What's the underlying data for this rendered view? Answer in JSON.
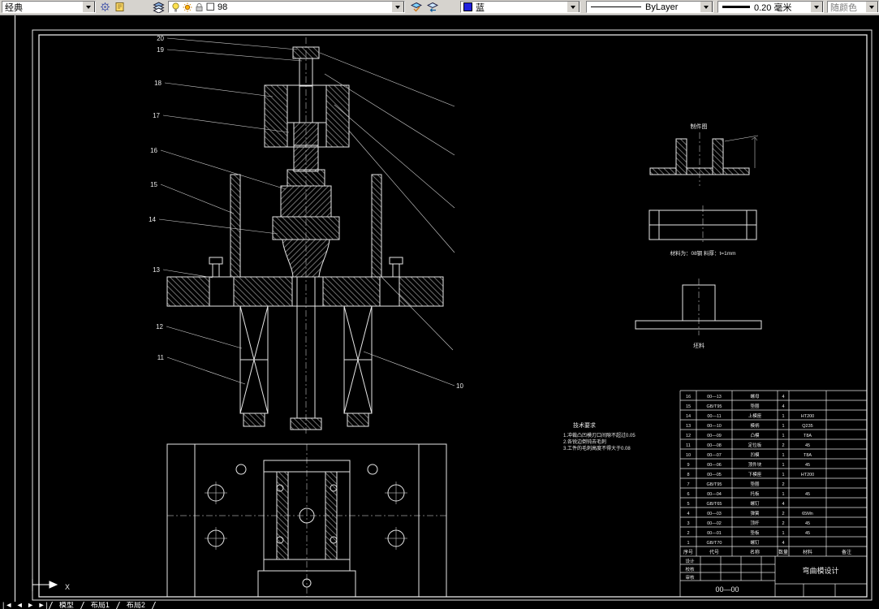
{
  "toolbar": {
    "workspace": "经典",
    "layer_value": "98",
    "color_value": "蓝",
    "linetype_value": "ByLayer",
    "lineweight_value": "0.20 毫米",
    "plotstyle_value": "随颜色",
    "icons": [
      "gear-icon",
      "sheet-icon",
      "layers-icon",
      "bulb-icon",
      "sun-icon",
      "lock-icon",
      "color-chip-icon",
      "make-layer-current-icon",
      "layer-previous-icon"
    ]
  },
  "drawing": {
    "balloon_labels_left": [
      "20",
      "19",
      "18",
      "17",
      "16",
      "15",
      "14",
      "13",
      "12",
      "11"
    ],
    "balloon_label_right": "10",
    "detail_view_title": "制件图",
    "material_note": "材料为：08钢  料厚：t=1mm",
    "blank_label": "坯料",
    "tech_requirements": {
      "title": "技术要求",
      "items": [
        "1.冲裁凸凹模刃口间隙不超过0.05",
        "2.各锐边倒钝去毛刺",
        "3.工件的毛刺高度不得大于0.08"
      ]
    }
  },
  "title_block": {
    "drawing_title": "弯曲模设计",
    "drawing_number": "00—00",
    "bom_header": {
      "no": "序号",
      "code": "代号",
      "name": "名称",
      "qty": "数量",
      "mat": "材料",
      "rem": "备注"
    },
    "fields": {
      "design": "设计",
      "check": "校核",
      "approve": "审核"
    },
    "bom": [
      {
        "no": "16",
        "code": "00—13",
        "name": "螺母",
        "qty": "4",
        "mat": "",
        "rem": ""
      },
      {
        "no": "15",
        "code": "GB/T95",
        "name": "垫圈",
        "qty": "4",
        "mat": "",
        "rem": ""
      },
      {
        "no": "14",
        "code": "00—11",
        "name": "上模座",
        "qty": "1",
        "mat": "HT200",
        "rem": ""
      },
      {
        "no": "13",
        "code": "00—10",
        "name": "模柄",
        "qty": "1",
        "mat": "Q235",
        "rem": ""
      },
      {
        "no": "12",
        "code": "00—09",
        "name": "凸模",
        "qty": "1",
        "mat": "T8A",
        "rem": ""
      },
      {
        "no": "11",
        "code": "00—08",
        "name": "定位板",
        "qty": "2",
        "mat": "45",
        "rem": ""
      },
      {
        "no": "10",
        "code": "00—07",
        "name": "凹模",
        "qty": "1",
        "mat": "T8A",
        "rem": ""
      },
      {
        "no": "9",
        "code": "00—06",
        "name": "顶件块",
        "qty": "1",
        "mat": "45",
        "rem": ""
      },
      {
        "no": "8",
        "code": "00—05",
        "name": "下模座",
        "qty": "1",
        "mat": "HT200",
        "rem": ""
      },
      {
        "no": "7",
        "code": "GB/T95",
        "name": "垫圈",
        "qty": "2",
        "mat": "",
        "rem": ""
      },
      {
        "no": "6",
        "code": "00—04",
        "name": "托板",
        "qty": "1",
        "mat": "45",
        "rem": ""
      },
      {
        "no": "5",
        "code": "GB/T65",
        "name": "螺钉",
        "qty": "4",
        "mat": "",
        "rem": ""
      },
      {
        "no": "4",
        "code": "00—03",
        "name": "弹簧",
        "qty": "2",
        "mat": "65Mn",
        "rem": ""
      },
      {
        "no": "3",
        "code": "00—02",
        "name": "顶杆",
        "qty": "2",
        "mat": "45",
        "rem": ""
      },
      {
        "no": "2",
        "code": "00—01",
        "name": "垫板",
        "qty": "1",
        "mat": "45",
        "rem": ""
      },
      {
        "no": "1",
        "code": "GB/T70",
        "name": "螺钉",
        "qty": "4",
        "mat": "",
        "rem": ""
      }
    ]
  },
  "statusbar": {
    "nav_icons": "|◄ ◄ ► ►|",
    "tabs": [
      "模型",
      "布局1",
      "布局2"
    ]
  },
  "ucs": {
    "x_label": "X"
  }
}
